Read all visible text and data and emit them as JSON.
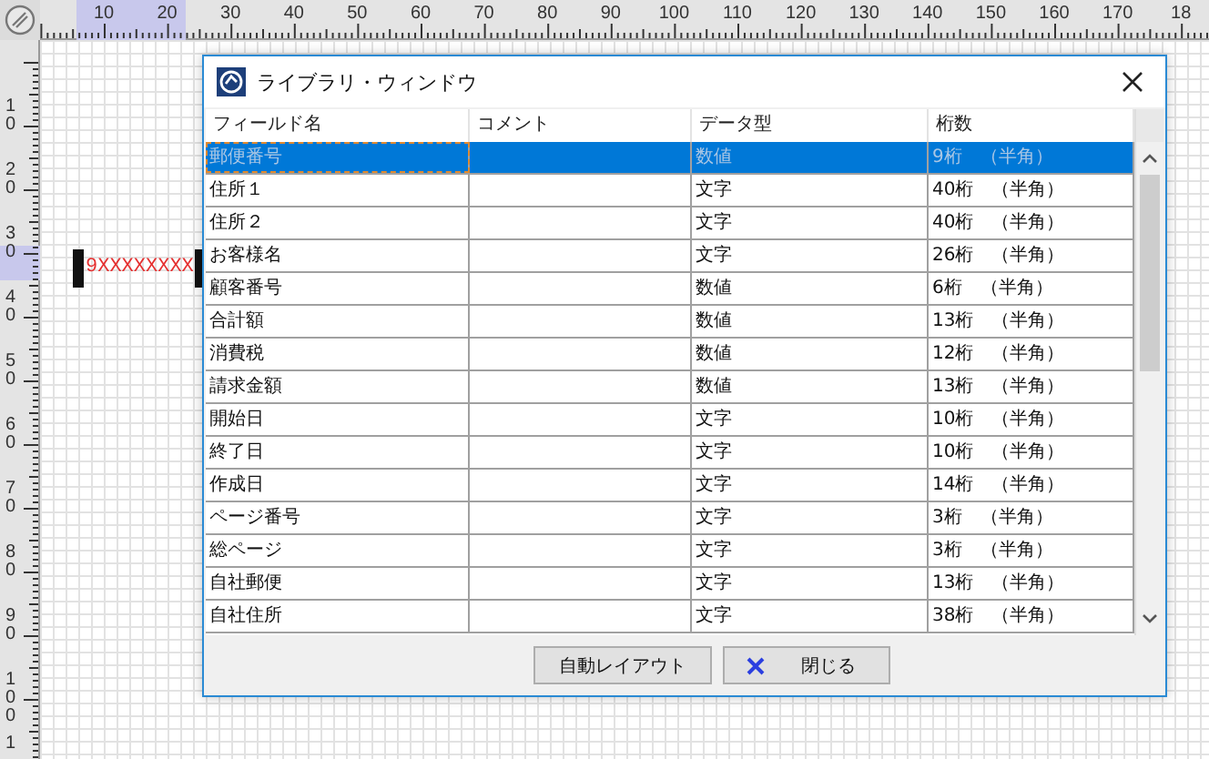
{
  "ruler_top": {
    "labels": [
      "10",
      "20",
      "30",
      "40",
      "50",
      "60",
      "70",
      "80",
      "90",
      "100",
      "110",
      "120",
      "130",
      "140",
      "150",
      "160",
      "170",
      "18"
    ]
  },
  "ruler_left": {
    "labels": [
      "10",
      "20",
      "30",
      "40",
      "50",
      "60",
      "70",
      "80",
      "90",
      "100",
      "1"
    ]
  },
  "canvas": {
    "field": {
      "text": "9XXXXXXXX",
      "selected": true
    }
  },
  "dialog": {
    "title": "ライブラリ・ウィンドウ",
    "columns": [
      "フィールド名",
      "コメント",
      "データ型",
      "桁数"
    ],
    "rows": [
      {
        "field": "郵便番号",
        "type": "数値",
        "digits": "9桁　（半角）",
        "selected": true
      },
      {
        "field": "住所１",
        "type": "文字",
        "digits": "40桁　（半角）",
        "selected": false
      },
      {
        "field": "住所２",
        "type": "文字",
        "digits": "40桁　（半角）",
        "selected": false
      },
      {
        "field": "お客様名",
        "type": "文字",
        "digits": "26桁　（半角）",
        "selected": false
      },
      {
        "field": "顧客番号",
        "type": "数値",
        "digits": "6桁　（半角）",
        "selected": false
      },
      {
        "field": "合計額",
        "type": "数値",
        "digits": "13桁　（半角）",
        "selected": false
      },
      {
        "field": "消費税",
        "type": "数値",
        "digits": "12桁　（半角）",
        "selected": false
      },
      {
        "field": "請求金額",
        "type": "数値",
        "digits": "13桁　（半角）",
        "selected": false
      },
      {
        "field": "開始日",
        "type": "文字",
        "digits": "10桁　（半角）",
        "selected": false
      },
      {
        "field": "終了日",
        "type": "文字",
        "digits": "10桁　（半角）",
        "selected": false
      },
      {
        "field": "作成日",
        "type": "文字",
        "digits": "14桁　（半角）",
        "selected": false
      },
      {
        "field": "ページ番号",
        "type": "文字",
        "digits": "3桁　（半角）",
        "selected": false
      },
      {
        "field": "総ページ",
        "type": "文字",
        "digits": "3桁　（半角）",
        "selected": false
      },
      {
        "field": "自社郵便",
        "type": "文字",
        "digits": "13桁　（半角）",
        "selected": false
      },
      {
        "field": "自社住所",
        "type": "文字",
        "digits": "38桁　（半角）",
        "selected": false
      }
    ],
    "buttons": [
      {
        "label": "自動レイアウト",
        "kind": "plain"
      },
      {
        "label": "閉じる",
        "kind": "close"
      }
    ]
  }
}
